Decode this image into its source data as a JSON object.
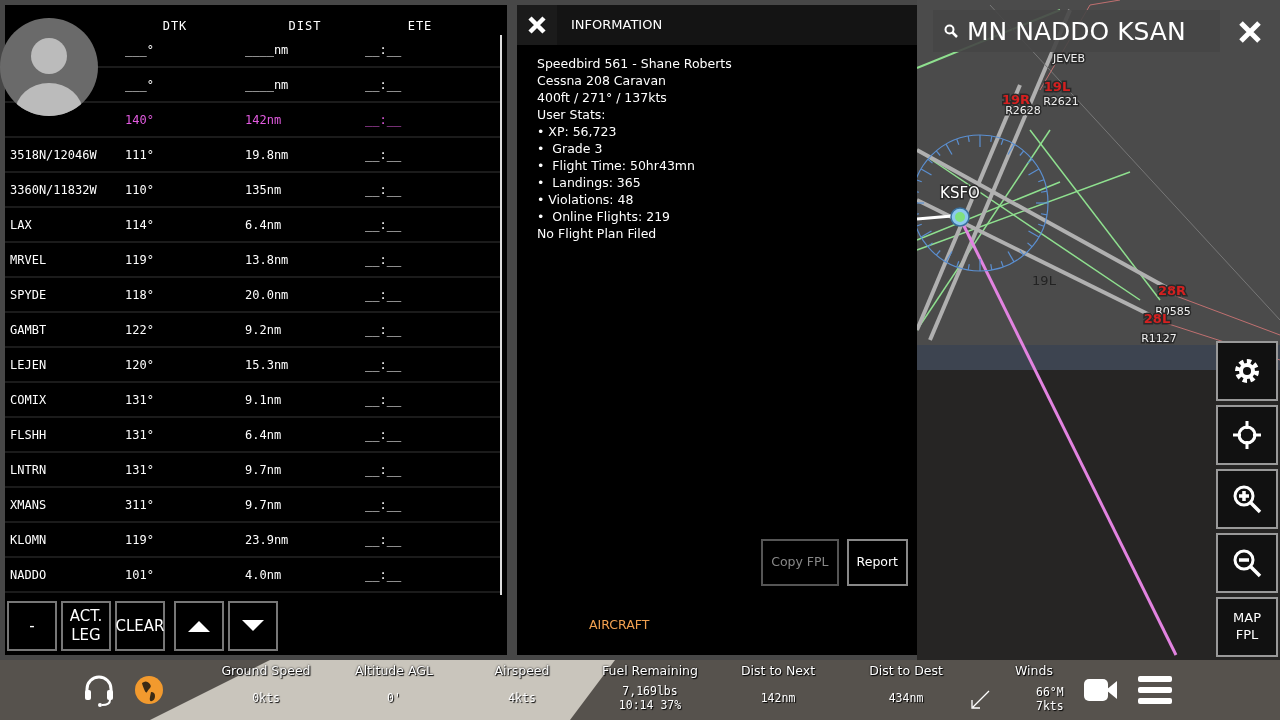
{
  "flight_plan": {
    "columns": [
      "DTK",
      "DIST",
      "ETE"
    ],
    "rows": [
      {
        "dtk": "___°",
        "dist": "____nm",
        "ete": "__:__",
        "active": false
      },
      {
        "dtk": "___°",
        "dist": "____nm",
        "ete": "__:__",
        "active": false
      },
      {
        "dtk": "140°",
        "dist": "142nm",
        "ete": "__:__",
        "active": true
      },
      {
        "name": "3518N/12046W",
        "dtk": "111°",
        "dist": "19.8nm",
        "ete": "__:__",
        "active": false
      },
      {
        "name": "3360N/11832W",
        "dtk": "110°",
        "dist": "135nm",
        "ete": "__:__",
        "active": false
      },
      {
        "name": "LAX",
        "dtk": "114°",
        "dist": "6.4nm",
        "ete": "__:__",
        "active": false
      },
      {
        "name": "MRVEL",
        "dtk": "119°",
        "dist": "13.8nm",
        "ete": "__:__",
        "active": false
      },
      {
        "name": "SPYDE",
        "dtk": "118°",
        "dist": "20.0nm",
        "ete": "__:__",
        "active": false
      },
      {
        "name": "GAMBT",
        "dtk": "122°",
        "dist": "9.2nm",
        "ete": "__:__",
        "active": false
      },
      {
        "name": "LEJEN",
        "dtk": "120°",
        "dist": "15.3nm",
        "ete": "__:__",
        "active": false
      },
      {
        "name": "COMIX",
        "dtk": "131°",
        "dist": "9.1nm",
        "ete": "__:__",
        "active": false
      },
      {
        "name": "FLSHH",
        "dtk": "131°",
        "dist": "6.4nm",
        "ete": "__:__",
        "active": false
      },
      {
        "name": "LNTRN",
        "dtk": "131°",
        "dist": "9.7nm",
        "ete": "__:__",
        "active": false
      },
      {
        "name": "XMANS",
        "dtk": "311°",
        "dist": "9.7nm",
        "ete": "__:__",
        "active": false
      },
      {
        "name": "KLOMN",
        "dtk": "119°",
        "dist": "23.9nm",
        "ete": "__:__",
        "active": false
      },
      {
        "name": "NADDO",
        "dtk": "101°",
        "dist": "4.0nm",
        "ete": "__:__",
        "active": false
      }
    ],
    "buttons": [
      {
        "label": "-",
        "kind": "text"
      },
      {
        "label": "ACT. LEG",
        "kind": "text"
      },
      {
        "label": "CLEAR",
        "kind": "text"
      },
      {
        "kind": "up"
      },
      {
        "kind": "down"
      }
    ]
  },
  "information": {
    "title": "INFORMATION",
    "lines": [
      "Speedbird 561 - Shane Roberts",
      "Cessna 208 Caravan",
      "400ft / 271° / 137kts",
      "User Stats:",
      "• XP: 56,723",
      "•  Grade 3",
      "•  Flight Time: 50hr43mn",
      "•  Landings: 365",
      "• Violations: 48",
      "•  Online Flights: 219",
      "No Flight Plan Filed"
    ],
    "buttons": [
      {
        "label": "Copy FPL",
        "disabled": true
      },
      {
        "label": "Report",
        "disabled": false
      }
    ],
    "tab": "AIRCRAFT"
  },
  "search": {
    "value": "MN NADDO KSAN"
  },
  "map": {
    "labels": [
      {
        "text": "JEVEB",
        "kind": "waypoint"
      },
      {
        "text": "19R",
        "kind": "runway"
      },
      {
        "text": "R2628",
        "kind": "waypoint"
      },
      {
        "text": "19L",
        "kind": "runway"
      },
      {
        "text": "R2621",
        "kind": "waypoint"
      },
      {
        "text": "KSFO",
        "kind": "airport"
      },
      {
        "text": "19L",
        "kind": "ground"
      },
      {
        "text": "28R",
        "kind": "runway"
      },
      {
        "text": "R0585",
        "kind": "waypoint"
      },
      {
        "text": "28L",
        "kind": "runway"
      },
      {
        "text": "R1127",
        "kind": "waypoint"
      }
    ]
  },
  "side_buttons": [
    {
      "kind": "settings"
    },
    {
      "kind": "locate"
    },
    {
      "kind": "zoom_in"
    },
    {
      "kind": "zoom_out"
    },
    {
      "kind": "text",
      "label": "MAP FPL"
    }
  ],
  "status_bar": {
    "stats": [
      {
        "label": "Ground Speed",
        "values": [
          "0kts"
        ]
      },
      {
        "label": "Altitude AGL",
        "values": [
          "0'"
        ]
      },
      {
        "label": "Airspeed",
        "values": [
          "4kts"
        ]
      },
      {
        "label": "Fuel Remaining",
        "values": [
          "7,169lbs",
          "10:14 37%"
        ]
      },
      {
        "label": "Dist to Next",
        "values": [
          "142nm"
        ]
      },
      {
        "label": "Dist to Dest",
        "values": [
          "434nm"
        ]
      },
      {
        "label": "Winds"
      }
    ],
    "winds": [
      "66°M",
      "7kts"
    ]
  }
}
